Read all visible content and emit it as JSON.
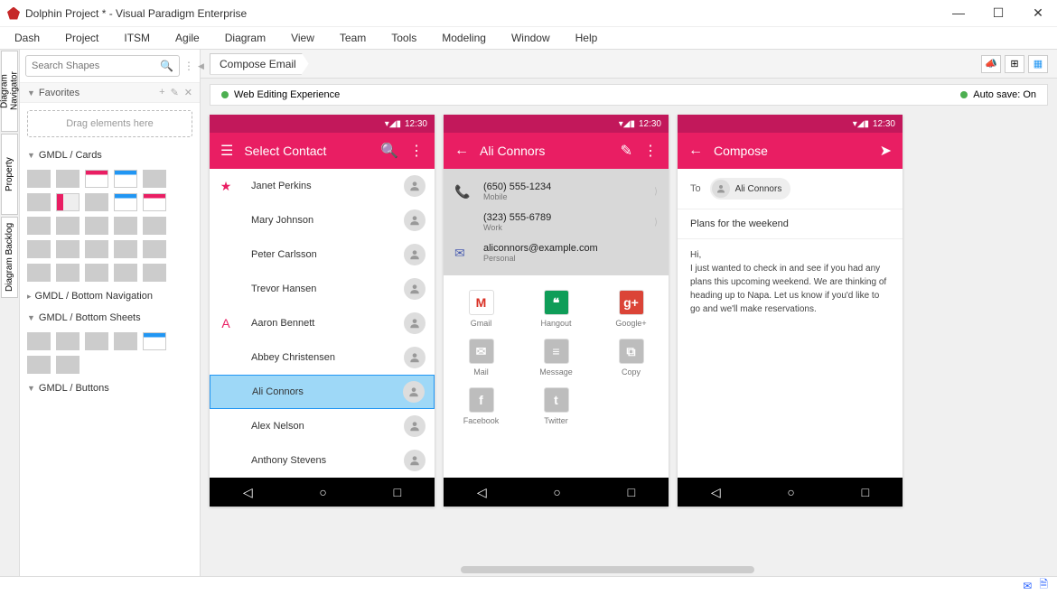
{
  "app": {
    "title": "Dolphin Project * - Visual Paradigm Enterprise"
  },
  "menu": [
    "Dash",
    "Project",
    "ITSM",
    "Agile",
    "Diagram",
    "View",
    "Team",
    "Tools",
    "Modeling",
    "Window",
    "Help"
  ],
  "vtabs": [
    "Diagram Navigator",
    "Property",
    "Diagram Backlog"
  ],
  "breadcrumb": "Compose Email",
  "status_left": "Web Editing Experience",
  "status_right": "Auto save: On",
  "sidebar": {
    "search_placeholder": "Search Shapes",
    "favorites_label": "Favorites",
    "dropzone": "Drag elements here",
    "sections": [
      "GMDL / Cards",
      "GMDL / Bottom Navigation",
      "GMDL / Bottom Sheets",
      "GMDL / Buttons"
    ]
  },
  "phones": {
    "time": "12:30",
    "contact_list": {
      "title": "Select Contact",
      "starred": [
        "Janet Perkins",
        "Mary Johnson",
        "Peter Carlsson",
        "Trevor Hansen"
      ],
      "letter": "A",
      "a_list": [
        "Aaron Bennett",
        "Abbey Christensen",
        "Ali Connors",
        "Alex Nelson",
        "Anthony Stevens"
      ],
      "selected": "Ali Connors"
    },
    "detail": {
      "title": "Ali Connors",
      "phones": [
        {
          "number": "(650) 555-1234",
          "label": "Mobile"
        },
        {
          "number": "(323) 555-6789",
          "label": "Work"
        }
      ],
      "email": {
        "address": "aliconnors@example.com",
        "label": "Personal"
      },
      "share": [
        {
          "name": "Gmail",
          "bg": "#fff",
          "fg": "#d93025",
          "glyph": "M"
        },
        {
          "name": "Hangout",
          "bg": "#0f9d58",
          "fg": "#fff",
          "glyph": "❝"
        },
        {
          "name": "Google+",
          "bg": "#db4437",
          "fg": "#fff",
          "glyph": "g+"
        },
        {
          "name": "Mail",
          "bg": "#bdbdbd",
          "fg": "#fff",
          "glyph": "✉"
        },
        {
          "name": "Message",
          "bg": "#bdbdbd",
          "fg": "#fff",
          "glyph": "≡"
        },
        {
          "name": "Copy",
          "bg": "#bdbdbd",
          "fg": "#fff",
          "glyph": "⧉"
        },
        {
          "name": "Facebook",
          "bg": "#bdbdbd",
          "fg": "#fff",
          "glyph": "f"
        },
        {
          "name": "Twitter",
          "bg": "#bdbdbd",
          "fg": "#fff",
          "glyph": "t"
        }
      ]
    },
    "compose": {
      "title": "Compose",
      "to_label": "To",
      "to_value": "Ali Connors",
      "subject": "Plans for the weekend",
      "body": "Hi,\nI just wanted to check in and see if you had any plans this upcoming weekend. We are thinking of heading up to Napa. Let us know if you'd like to go and we'll make reservations."
    }
  }
}
